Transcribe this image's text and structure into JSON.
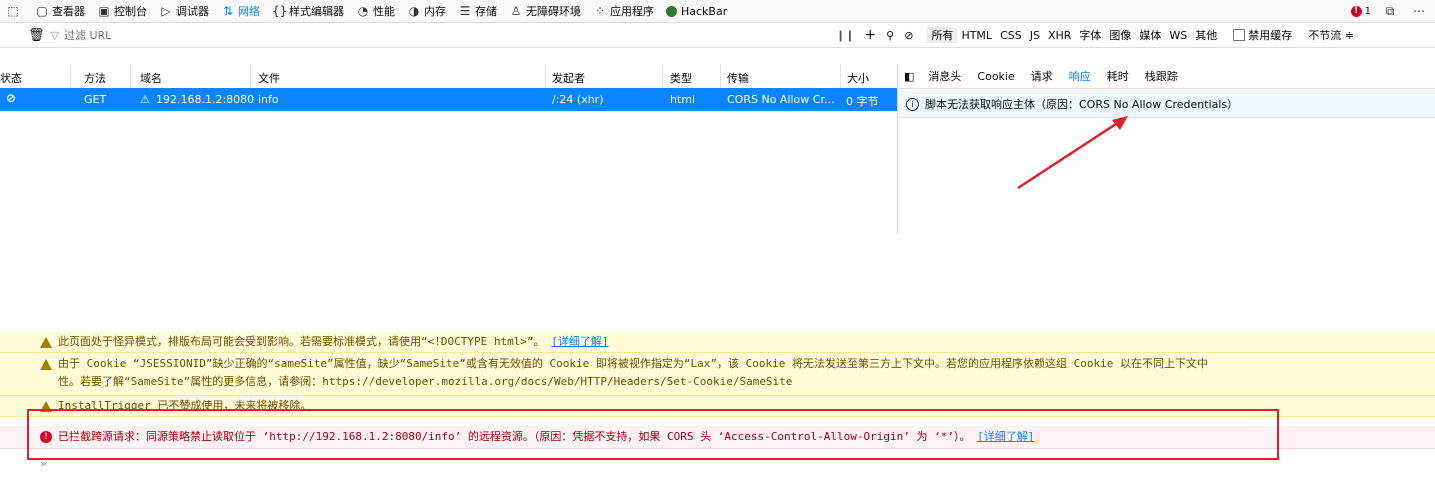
{
  "toolbar": {
    "items": [
      {
        "label": "查看器",
        "icon": "inspector-icon"
      },
      {
        "label": "控制台",
        "icon": "console-icon"
      },
      {
        "label": "调试器",
        "icon": "debugger-icon"
      },
      {
        "label": "网络",
        "icon": "network-icon",
        "active": true
      },
      {
        "label": "样式编辑器",
        "icon": "style-editor-icon"
      },
      {
        "label": "性能",
        "icon": "performance-icon"
      },
      {
        "label": "内存",
        "icon": "memory-icon"
      },
      {
        "label": "存储",
        "icon": "storage-icon"
      },
      {
        "label": "无障碍环境",
        "icon": "accessibility-icon"
      },
      {
        "label": "应用程序",
        "icon": "application-icon"
      },
      {
        "label": "HackBar",
        "icon": "hackbar-icon"
      }
    ],
    "error_count": "1"
  },
  "filter": {
    "placeholder": "过滤 URL",
    "types": [
      "所有",
      "HTML",
      "CSS",
      "JS",
      "XHR",
      "字体",
      "图像",
      "媒体",
      "WS",
      "其他"
    ],
    "disable_cache": "禁用缓存",
    "throttle": "不节流 ≑"
  },
  "table": {
    "headers": {
      "status": "状态",
      "method": "方法",
      "domain": "域名",
      "file": "文件",
      "initiator": "发起者",
      "type": "类型",
      "transfer": "传输",
      "size": "大小"
    },
    "row": {
      "method": "GET",
      "domain": "192.168.1.2:8080",
      "file": "info",
      "initiator": "/:24 (xhr)",
      "type": "html",
      "transfer": "CORS No Allow Cr...",
      "size": "0 字节"
    }
  },
  "side": {
    "tabs": [
      "消息头",
      "Cookie",
      "请求",
      "响应",
      "耗时",
      "栈跟踪"
    ],
    "selected_tab": "响应",
    "message": "脚本无法获取响应主体（原因：CORS No Allow Credentials）"
  },
  "console": {
    "m1_text": "此页面处于怪异模式，排版布局可能会受到影响。若需要标准模式，请使用“<!DOCTYPE html>”。",
    "m1_link": "[详细了解]",
    "m2_line1": "由于 Cookie “JSESSIONID”缺少正确的“sameSite”属性值，缺少“SameSite”或含有无效值的 Cookie 即将被视作指定为“Lax”，该 Cookie 将无法发送至第三方上下文中。若您的应用程序依赖这组 Cookie 以在不同上下文中",
    "m2_line2": "性。若要了解“SameSite”属性的更多信息，请参阅：https://developer.mozilla.org/docs/Web/HTTP/Headers/Set-Cookie/SameSite",
    "m3_text": "InstallTrigger 已不赞成使用，未来将被移除。",
    "m4_text": "已拦截跨源请求：同源策略禁止读取位于 ‘http://192.168.1.2:8080/info’ 的远程资源。（原因：凭据不支持，如果 CORS 头 ‘Access-Control-Allow-Origin’ 为 ‘*’）。",
    "m4_link": "[详细了解]",
    "prompt": "»"
  }
}
